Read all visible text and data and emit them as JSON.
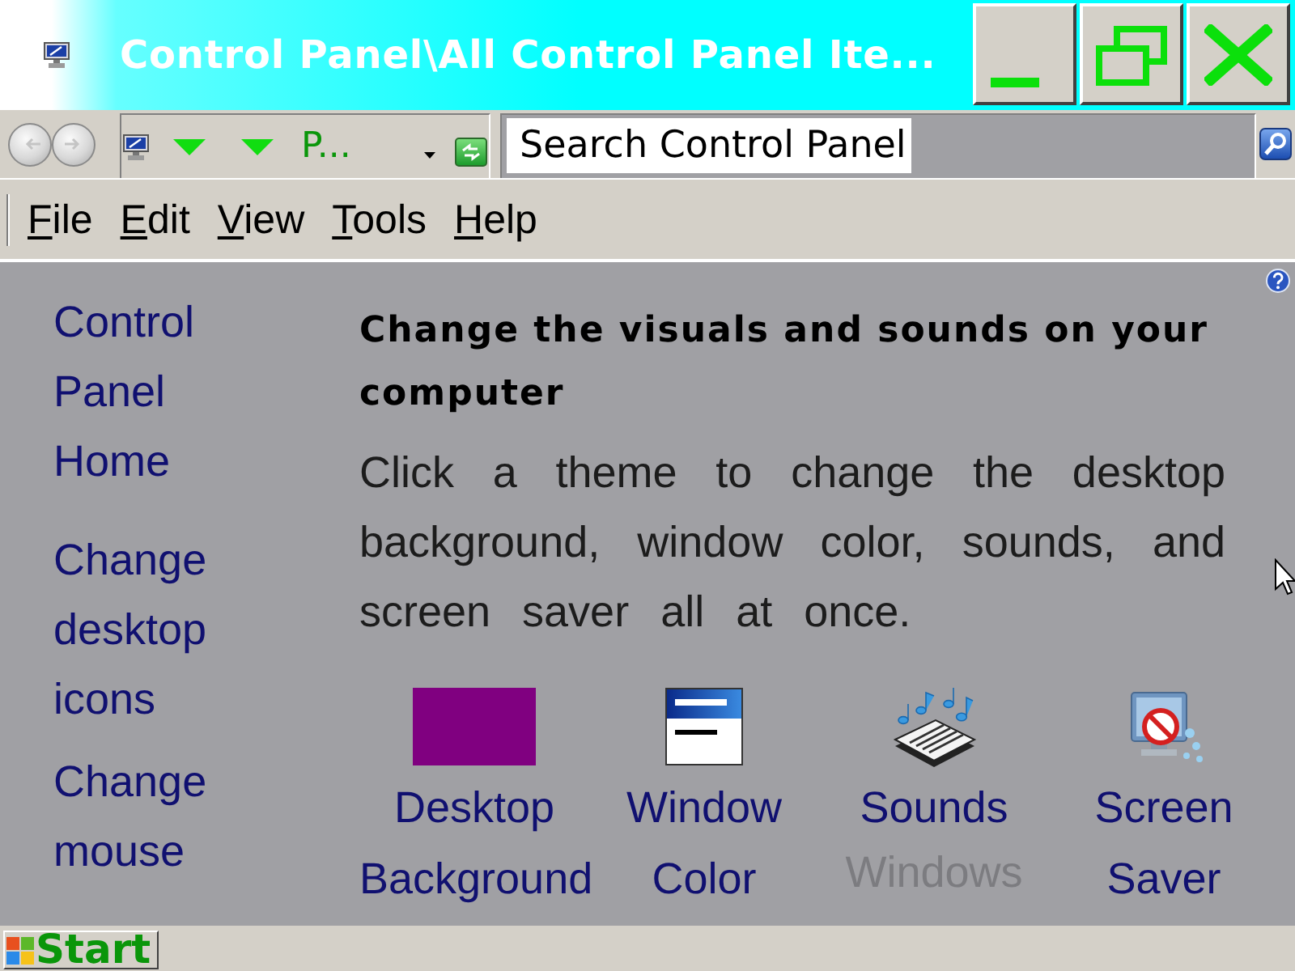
{
  "window": {
    "title": "Control Panel\\All Control Panel Ite..."
  },
  "address_bar": {
    "breadcrumb": "P...",
    "search": {
      "placeholder": "Search Control Panel"
    }
  },
  "menu": [
    "File",
    "Edit",
    "View",
    "Tools",
    "Help"
  ],
  "sidebar": {
    "links": [
      "Control Panel Home",
      "Change desktop icons",
      "Change mouse"
    ]
  },
  "content": {
    "heading": "Change the visuals and sounds on your computer",
    "description": "Click a theme to change the desktop background, window color, sounds, and screen saver all at once.",
    "items": [
      {
        "kind": "swatch",
        "label": "Desktop Background",
        "color": "#800080"
      },
      {
        "kind": "window",
        "label": "Window Color"
      },
      {
        "kind": "sounds",
        "label": "Sounds",
        "subtitle": "Windows"
      },
      {
        "kind": "screensaver",
        "label": "Screen Saver"
      }
    ]
  },
  "taskbar": {
    "start": "Start"
  }
}
